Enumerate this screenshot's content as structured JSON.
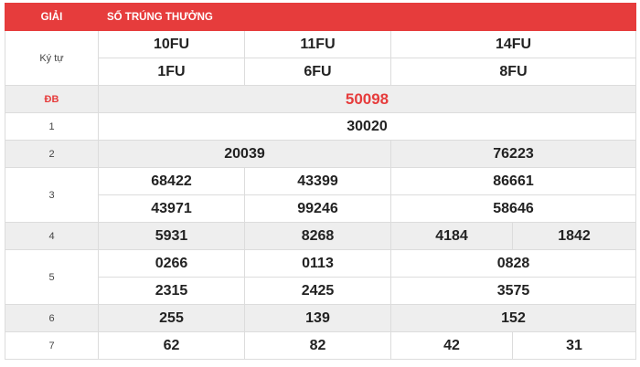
{
  "header": {
    "col_prize": "GIẢI",
    "col_numbers": "SỐ TRÚNG THƯỞNG"
  },
  "symbols": {
    "label": "Ký tự",
    "row1": [
      "10FU",
      "11FU",
      "14FU"
    ],
    "row2": [
      "1FU",
      "6FU",
      "8FU"
    ]
  },
  "prizes": {
    "db": {
      "label": "ĐB",
      "numbers": [
        "50098"
      ]
    },
    "p1": {
      "label": "1",
      "numbers": [
        "30020"
      ]
    },
    "p2": {
      "label": "2",
      "numbers": [
        "20039",
        "76223"
      ]
    },
    "p3": {
      "label": "3",
      "numbers": [
        "68422",
        "43399",
        "86661",
        "43971",
        "99246",
        "58646"
      ]
    },
    "p4": {
      "label": "4",
      "numbers": [
        "5931",
        "8268",
        "4184",
        "1842"
      ]
    },
    "p5": {
      "label": "5",
      "numbers": [
        "0266",
        "0113",
        "0828",
        "2315",
        "2425",
        "3575"
      ]
    },
    "p6": {
      "label": "6",
      "numbers": [
        "255",
        "139",
        "152"
      ]
    },
    "p7": {
      "label": "7",
      "numbers": [
        "62",
        "82",
        "42",
        "31"
      ]
    }
  },
  "colors": {
    "accent": "#e63c3c",
    "row_alt": "#eeeeee"
  }
}
